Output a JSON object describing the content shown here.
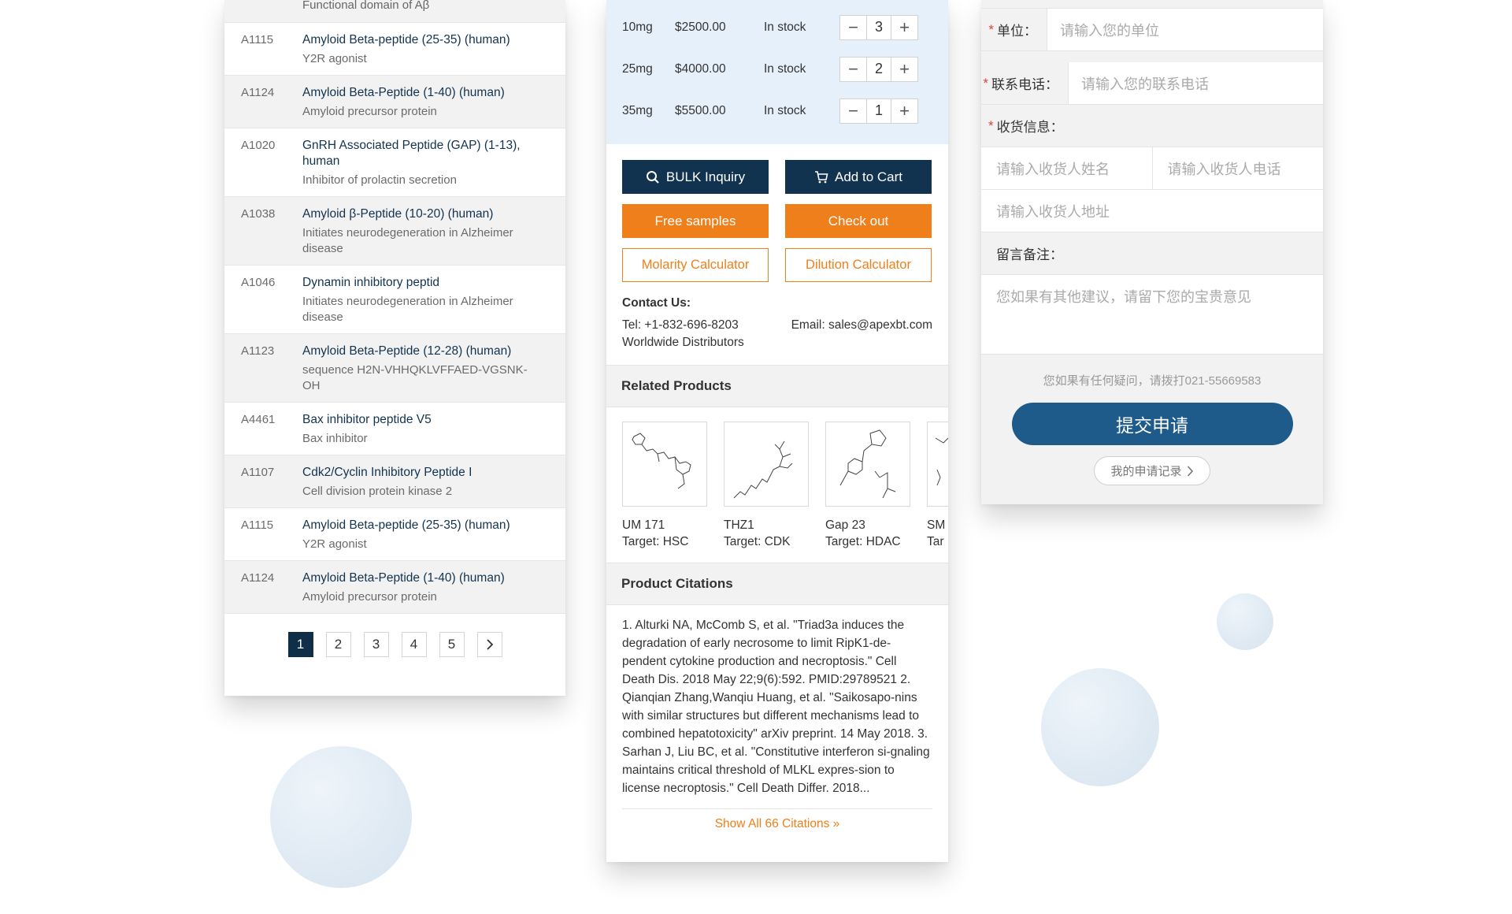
{
  "list_panel": {
    "top_fragment": "Functional domain of Aβ",
    "items": [
      {
        "code": "A1115",
        "title": "Amyloid Beta-peptide (25-35) (human)",
        "desc": "Y2R agonist"
      },
      {
        "code": "A1124",
        "title": "Amyloid Beta-Peptide (1-40) (human)",
        "desc": "Amyloid precursor protein"
      },
      {
        "code": "A1020",
        "title": "GnRH Associated Peptide (GAP) (1-13), human",
        "desc": "Inhibitor of prolactin secretion"
      },
      {
        "code": "A1038",
        "title": "Amyloid β-Peptide (10-20) (human)",
        "desc": "Initiates neurodegeneration in Alzheimer disease"
      },
      {
        "code": "A1046",
        "title": "Dynamin inhibitory peptid",
        "desc": "Initiates neurodegeneration in Alzheimer disease"
      },
      {
        "code": "A1123",
        "title": "Amyloid Beta-Peptide (12-28) (human)",
        "desc": "sequence H2N-VHHQKLVFFAED-VGSNK-OH"
      },
      {
        "code": "A4461",
        "title": "Bax inhibitor peptide V5",
        "desc": "Bax inhibitor"
      },
      {
        "code": "A1107",
        "title": "Cdk2/Cyclin Inhibitory Peptide I",
        "desc": "Cell division protein kinase 2"
      },
      {
        "code": "A1115",
        "title": "Amyloid Beta-peptide (25-35) (human)",
        "desc": "Y2R agonist"
      },
      {
        "code": "A1124",
        "title": "Amyloid Beta-Peptide (1-40) (human)",
        "desc": "Amyloid precursor protein"
      }
    ],
    "pages": [
      "1",
      "2",
      "3",
      "4",
      "5"
    ],
    "active_page": "1"
  },
  "product_panel": {
    "sizes": [
      {
        "size": "10mg",
        "price": "$2500.00",
        "stock": "In stock",
        "qty": "3"
      },
      {
        "size": "25mg",
        "price": "$4000.00",
        "stock": "In stock",
        "qty": "2"
      },
      {
        "size": "35mg",
        "price": "$5500.00",
        "stock": "In stock",
        "qty": "1"
      }
    ],
    "buttons": {
      "bulk": "BULK Inquiry",
      "cart": "Add to Cart",
      "samples": "Free samples",
      "checkout": "Check out",
      "molarity": "Molarity Calculator",
      "dilution": "Dilution Calculator"
    },
    "contact": {
      "title": "Contact Us:",
      "tel": "Tel: +1-832-696-8203",
      "email": "Email: sales@apexbt.com",
      "distributors": "Worldwide Distributors"
    },
    "related_title": "Related Products",
    "related": [
      {
        "name": "UM 171",
        "target": "Target: HSC"
      },
      {
        "name": "THZ1",
        "target": "Target: CDK"
      },
      {
        "name": "Gap 23",
        "target": "Target: HDAC"
      },
      {
        "name": "SM",
        "target": "Tar"
      }
    ],
    "citations_title": "Product Citations",
    "citations_text": "1. Alturki NA, McComb S, et al. \"Triad3a induces the degradation of early necrosome to limit RipK1-de-pendent cytokine production and necroptosis.\" Cell Death Dis. 2018 May 22;9(6):592. PMID:29789521 2. Qianqian Zhang,Wanqiu Huang, et al. \"Saikosapo-nins with similar structures but different mechanisms lead to combined hepatotoxicity\" arXiv preprint. 14 May 2018. 3. Sarhan J, Liu BC, et al. \"Constitutive interferon si-gnaling maintains critical threshold of MLKL expres-sion to license necroptosis.\" Cell Death Differ. 2018...",
    "show_all": "Show All 66 Citations"
  },
  "form_panel": {
    "unit_label": "单位：",
    "unit_placeholder": "请输入您的单位",
    "phone_label": "联系电话：",
    "phone_placeholder": "请输入您的联系电话",
    "shipping_label": "收货信息：",
    "receiver_name_placeholder": "请输入收货人姓名",
    "receiver_phone_placeholder": "请输入收货人电话",
    "receiver_address_placeholder": "请输入收货人地址",
    "remark_label": "留言备注：",
    "remark_placeholder": "您如果有其他建议，请留下您的宝贵意见",
    "hint": "您如果有任何疑问，请拨打021-55669583",
    "submit": "提交申请",
    "records": "我的申请记录",
    "required_mark": "*"
  },
  "colors": {
    "navy": "#12334f",
    "orange": "#ef7f1a",
    "submit_blue": "#1e5a8a",
    "stock_bg": "#e6f0fb"
  }
}
